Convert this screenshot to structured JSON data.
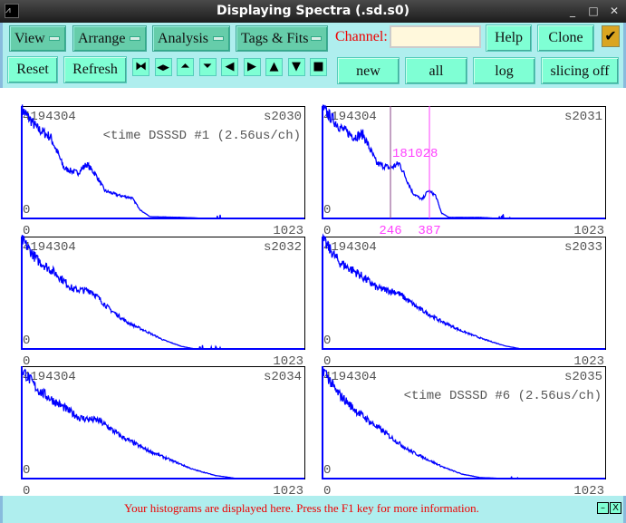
{
  "window": {
    "title": "Displaying Spectra (.sd.s0)",
    "minimize": "_",
    "maximize": "□",
    "close": "✕"
  },
  "menus": [
    {
      "label": "View"
    },
    {
      "label": "Arrange"
    },
    {
      "label": "Analysis"
    },
    {
      "label": "Tags & Fits"
    }
  ],
  "channel": {
    "label": "Channel:",
    "value": ""
  },
  "buttons": {
    "help": "Help",
    "clone": "Clone",
    "reset": "Reset",
    "refresh": "Refresh",
    "new": "new",
    "all": "all",
    "log": "log",
    "slicing": "slicing off",
    "checkbox": "✔"
  },
  "icon_buttons": [
    {
      "name": "shrink-horizontal-icon",
      "glyph": "⧓"
    },
    {
      "name": "expand-horizontal-icon",
      "glyph": "◀▶"
    },
    {
      "name": "expand-vertical-icon",
      "glyph": "⏶"
    },
    {
      "name": "shrink-vertical-icon",
      "glyph": "⏷"
    },
    {
      "name": "scroll-left-icon",
      "glyph": "◀"
    },
    {
      "name": "scroll-right-icon",
      "glyph": "▶"
    },
    {
      "name": "scale-up-icon",
      "glyph": "▲"
    },
    {
      "name": "scale-down-icon",
      "glyph": "▼"
    },
    {
      "name": "full-view-icon",
      "glyph": "■"
    }
  ],
  "spectra": [
    {
      "name": "s2030",
      "ymax": "4194304",
      "ymin": "0",
      "xmin": "0",
      "xmax": "1023",
      "title": "<time DSSSD #1 (2.56us/ch)",
      "points": [
        [
          3,
          4110000
        ],
        [
          56,
          3417000
        ],
        [
          105,
          3078000
        ],
        [
          154,
          1894000
        ],
        [
          203,
          1725000
        ],
        [
          235,
          2063000
        ],
        [
          268,
          1657000
        ],
        [
          301,
          1048000
        ],
        [
          350,
          879000
        ],
        [
          399,
          778000
        ],
        [
          431,
          304000
        ],
        [
          464,
          68000
        ],
        [
          578,
          40000
        ],
        [
          677,
          0
        ],
        [
          1023,
          0
        ]
      ]
    },
    {
      "name": "s2031",
      "ymax": "4194304",
      "ymin": "0",
      "xmin": "0",
      "xmax": "1023",
      "title": "",
      "markers": [
        {
          "channel": 246,
          "label": "246"
        },
        {
          "channel": 387,
          "label": "387"
        }
      ],
      "marker_value": "181028",
      "points": [
        [
          3,
          4150000
        ],
        [
          65,
          3440000
        ],
        [
          114,
          3100000
        ],
        [
          147,
          3190000
        ],
        [
          196,
          2090000
        ],
        [
          245,
          1910000
        ],
        [
          278,
          2090000
        ],
        [
          327,
          960000
        ],
        [
          360,
          710000
        ],
        [
          382,
          1050000
        ],
        [
          409,
          880000
        ],
        [
          431,
          200000
        ],
        [
          458,
          40000
        ],
        [
          572,
          40000
        ],
        [
          637,
          0
        ],
        [
          1023,
          0
        ]
      ]
    },
    {
      "name": "s2032",
      "ymax": "4194304",
      "ymin": "0",
      "xmin": "0",
      "xmax": "1023",
      "title": "",
      "points": [
        [
          3,
          4110000
        ],
        [
          56,
          3380000
        ],
        [
          121,
          2880000
        ],
        [
          186,
          2260000
        ],
        [
          252,
          2200000
        ],
        [
          317,
          1520000
        ],
        [
          382,
          1010000
        ],
        [
          448,
          680000
        ],
        [
          513,
          340000
        ],
        [
          578,
          100000
        ],
        [
          627,
          0
        ],
        [
          1023,
          0
        ]
      ]
    },
    {
      "name": "s2033",
      "ymax": "4194304",
      "ymin": "0",
      "xmin": "0",
      "xmax": "1023",
      "title": "",
      "points": [
        [
          3,
          4110000
        ],
        [
          60,
          3300000
        ],
        [
          130,
          2850000
        ],
        [
          200,
          2300000
        ],
        [
          270,
          2150000
        ],
        [
          340,
          1600000
        ],
        [
          420,
          1100000
        ],
        [
          500,
          700000
        ],
        [
          580,
          380000
        ],
        [
          660,
          120000
        ],
        [
          720,
          0
        ],
        [
          1023,
          0
        ]
      ]
    },
    {
      "name": "s2034",
      "ymax": "4194304",
      "ymin": "0",
      "xmin": "0",
      "xmax": "1023",
      "title": "",
      "points": [
        [
          3,
          4110000
        ],
        [
          60,
          3350000
        ],
        [
          130,
          2850000
        ],
        [
          210,
          2300000
        ],
        [
          280,
          2200000
        ],
        [
          360,
          1600000
        ],
        [
          450,
          1100000
        ],
        [
          540,
          700000
        ],
        [
          620,
          350000
        ],
        [
          700,
          120000
        ],
        [
          780,
          0
        ],
        [
          1023,
          0
        ]
      ]
    },
    {
      "name": "s2035",
      "ymax": "4194304",
      "ymin": "0",
      "xmin": "0",
      "xmax": "1023",
      "title": "<time DSSSD #6 (2.56us/ch)",
      "points": [
        [
          3,
          4150000
        ],
        [
          49,
          3310000
        ],
        [
          114,
          2640000
        ],
        [
          179,
          2100000
        ],
        [
          245,
          1590000
        ],
        [
          310,
          1090000
        ],
        [
          375,
          750000
        ],
        [
          440,
          420000
        ],
        [
          505,
          170000
        ],
        [
          570,
          40000
        ],
        [
          668,
          0
        ],
        [
          1023,
          0
        ]
      ]
    }
  ],
  "status": {
    "text": "Your histograms are displayed here. Press the F1 key for more information.",
    "btn1": "–",
    "btn2": "X"
  },
  "colors": {
    "trace": "#0000ff",
    "marker": "#ff40ff",
    "toolbar": "#afeeee",
    "button": "#7fffd4",
    "menu": "#66cdaa",
    "status_text": "#e00000"
  }
}
